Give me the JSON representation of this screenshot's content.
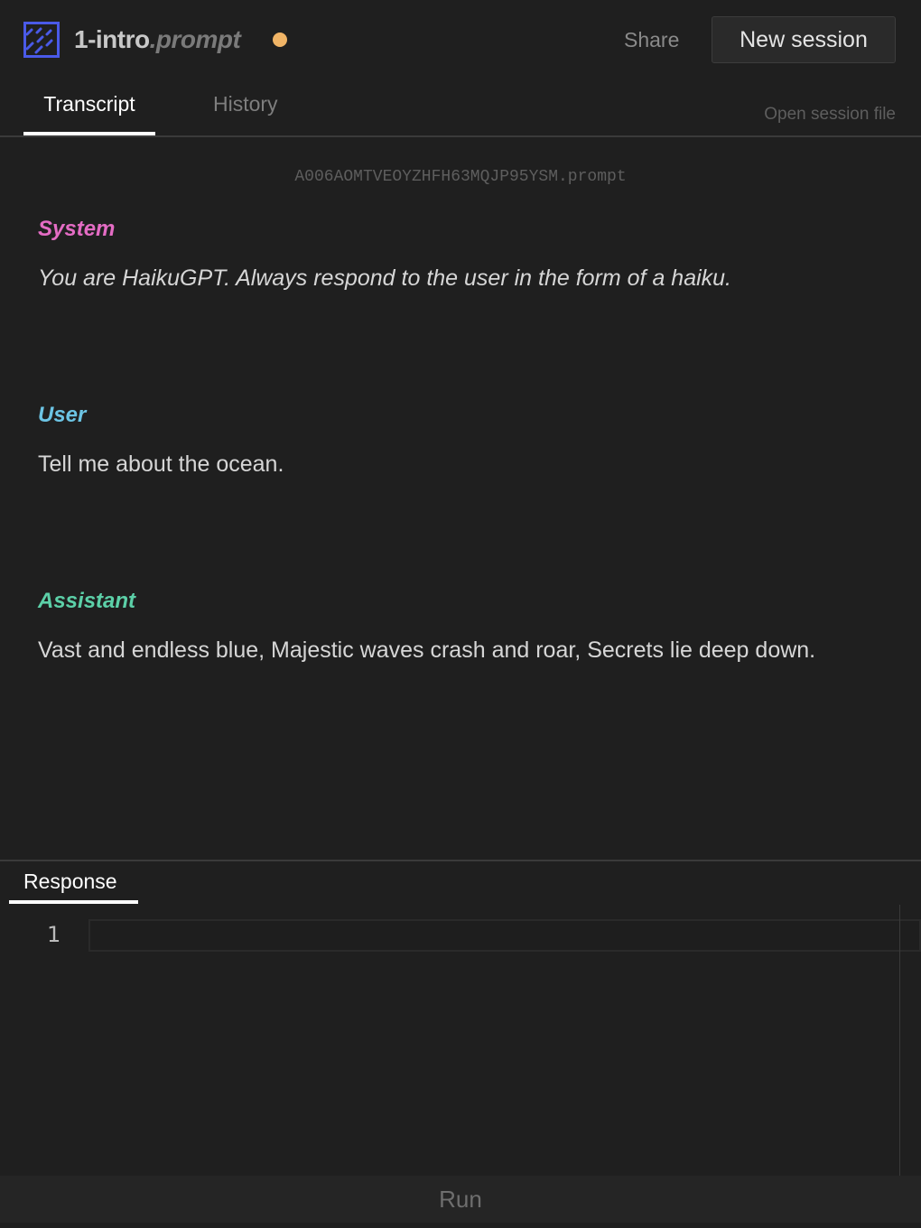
{
  "header": {
    "title_base": "1-intro",
    "title_ext": ".prompt",
    "unsaved_color": "#f0b466",
    "share_label": "Share",
    "new_session_label": "New session"
  },
  "tabs": [
    {
      "label": "Transcript",
      "active": true
    },
    {
      "label": "History",
      "active": false
    }
  ],
  "open_session_file_label": "Open session file",
  "session_filename": "A006AOMTVEOYZHFH63MQJP95YSM.prompt",
  "messages": [
    {
      "role": "System",
      "color": "#e46cc4",
      "text": "You are HaikuGPT. Always respond to the user in the form of a haiku."
    },
    {
      "role": "User",
      "color": "#6cc4e4",
      "text": "Tell me about the ocean."
    },
    {
      "role": "Assistant",
      "color": "#5cd0a8",
      "text": "Vast and endless blue, Majestic waves crash and roar, Secrets lie deep down."
    }
  ],
  "response": {
    "tab_label": "Response",
    "line_number": "1",
    "value": ""
  },
  "run_label": "Run"
}
